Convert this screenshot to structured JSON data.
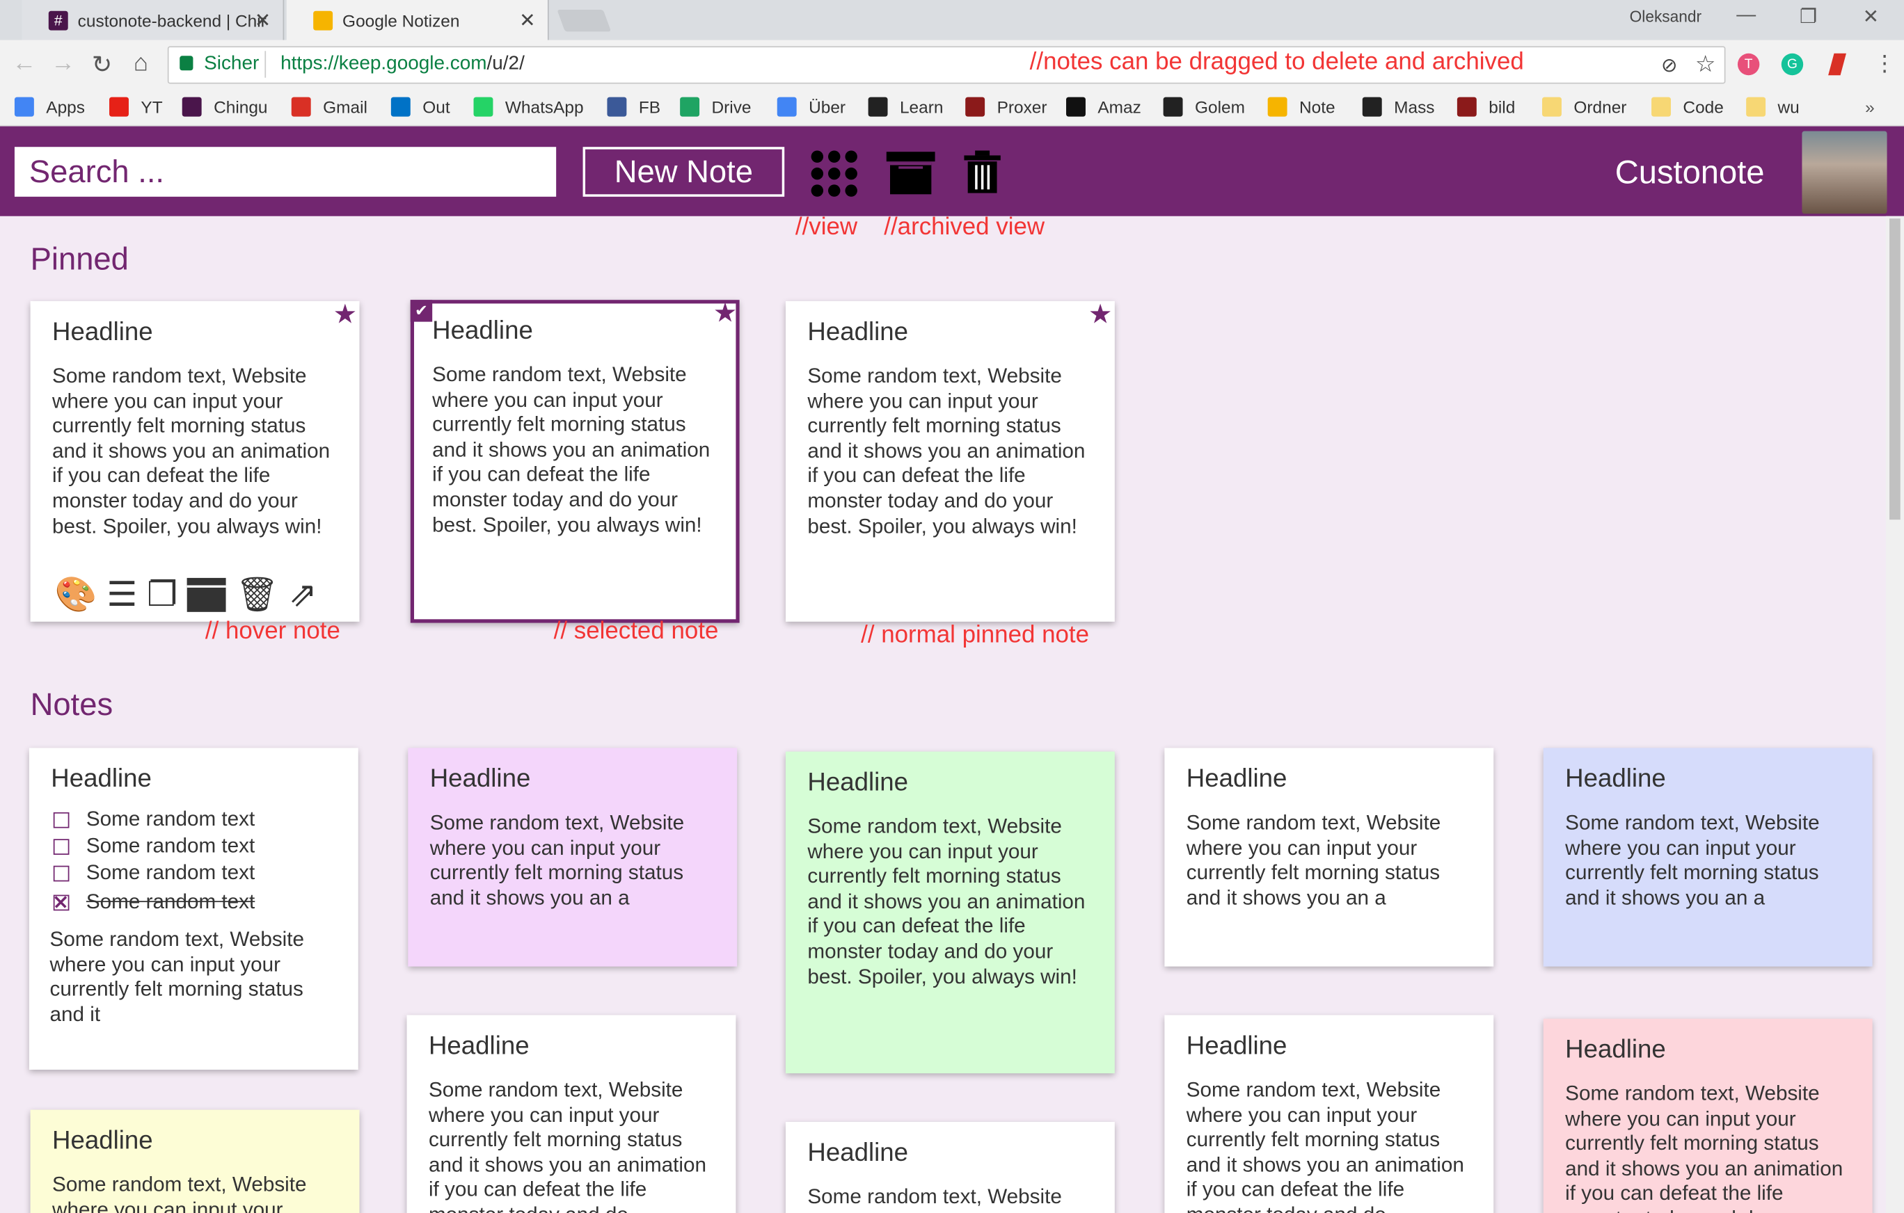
{
  "browser": {
    "tabs": [
      {
        "title": "custonote-backend | Chir",
        "favicon_color": "#4a154b"
      },
      {
        "title": "Google Notizen",
        "favicon_color": "#f6b400"
      }
    ],
    "profile": "Oleksandr",
    "security_label": "Sicher",
    "url_scheme_host": "https://keep.google.com",
    "url_path": "/u/2/",
    "bookmarks": [
      {
        "label": "Apps",
        "color": "#4285f4"
      },
      {
        "label": "YT",
        "color": "#e62117"
      },
      {
        "label": "Chingu",
        "color": "#4a154b"
      },
      {
        "label": "Gmail",
        "color": "#d93025"
      },
      {
        "label": "Out",
        "color": "#0072c6"
      },
      {
        "label": "WhatsApp",
        "color": "#25d366"
      },
      {
        "label": "FB",
        "color": "#3b5998"
      },
      {
        "label": "Drive",
        "color": "#1fa463"
      },
      {
        "label": "Über",
        "color": "#4285f4"
      },
      {
        "label": "Learn",
        "color": "#222222"
      },
      {
        "label": "Proxer",
        "color": "#8b1a1a"
      },
      {
        "label": "Amaz",
        "color": "#111111"
      },
      {
        "label": "Golem",
        "color": "#222222"
      },
      {
        "label": "Note",
        "color": "#f6b400"
      },
      {
        "label": "Mass",
        "color": "#222222"
      },
      {
        "label": "bild",
        "color": "#8b1a1a"
      },
      {
        "label": "Ordner",
        "color": "#f7d774"
      },
      {
        "label": "Code",
        "color": "#f7d774"
      },
      {
        "label": "wu",
        "color": "#f7d774"
      }
    ],
    "overflow": "»"
  },
  "annotations": {
    "drag": "//notes can be dragged to delete and archived",
    "view": "//view",
    "archived_view": "//archived view",
    "hover": "// hover note",
    "selected": "// selected note",
    "normal": "// normal pinned note"
  },
  "app": {
    "search_placeholder": "Search ...",
    "new_note_label": "New Note",
    "brand": "Custonote",
    "pinned_heading": "Pinned",
    "notes_heading": "Notes"
  },
  "pinned": [
    {
      "headline": "Headline",
      "text": "Some random text, Website where you can input your currently felt morning status and it shows you an animation if you can defeat the life monster today and do your best. Spoiler, you always win!",
      "state": "hover"
    },
    {
      "headline": "Headline",
      "text": "Some random text, Website where you can input your currently felt morning status and it shows you an animation if you can defeat the life monster today and do your best. Spoiler, you always win!",
      "state": "selected"
    },
    {
      "headline": "Headline",
      "text": "Some random text, Website where you can input your currently felt morning status and it shows you an animation if you can defeat the life monster today and do your best. Spoiler, you always win!",
      "state": "normal"
    }
  ],
  "notes": [
    {
      "headline": "Headline",
      "color": "#ffffff",
      "checklist": [
        {
          "text": "Some random text",
          "checked": false
        },
        {
          "text": "Some random text",
          "checked": false
        },
        {
          "text": "Some random text",
          "checked": false
        },
        {
          "text": "Some random text",
          "checked": true
        }
      ],
      "text": "Some random text, Website where you can input your currently felt morning status and it"
    },
    {
      "headline": "Headline",
      "color": "#f4d6fb",
      "text": "Some random text, Website where you can input your currently felt morning status and it shows you an a"
    },
    {
      "headline": "Headline",
      "color": "#d6fdd6",
      "text": "Some random text, Website where you can input your currently felt morning status and it shows you an animation if you can defeat the life monster today and do your best. Spoiler, you always win!"
    },
    {
      "headline": "Headline",
      "color": "#ffffff",
      "text": "Some random text, Website where you can input your currently felt morning status and it shows you an a"
    },
    {
      "headline": "Headline",
      "color": "#d6dcfb",
      "text": "Some random text, Website where you can input your currently felt morning status and it shows you an a"
    },
    {
      "headline": "Headline",
      "color": "#fdfdd6",
      "text": "Some random text, Website where you can input your"
    },
    {
      "headline": "Headline",
      "color": "#ffffff",
      "text": "Some random text, Website where you can input your currently felt morning status and it shows you an animation if you can defeat the life monster today and do"
    },
    {
      "headline": "Headline",
      "color": "#ffffff",
      "text": "Some random text, Website"
    },
    {
      "headline": "Headline",
      "color": "#ffffff",
      "text": "Some random text, Website where you can input your currently felt morning status and it shows you an animation if you can defeat the life monster today and do"
    },
    {
      "headline": "Headline",
      "color": "#fdd6dc",
      "text": "Some random text, Website where you can input your currently felt morning status and it shows you an animation if you can defeat the life monster today and d"
    }
  ]
}
